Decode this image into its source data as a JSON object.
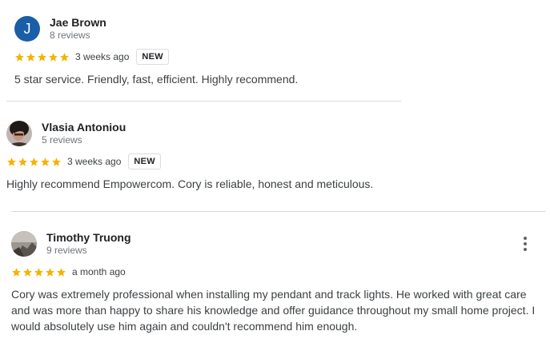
{
  "reviews": [
    {
      "avatar_letter": "J",
      "name": "Jae Brown",
      "review_count": "8 reviews",
      "stars": 5,
      "date": "3 weeks ago",
      "badge": "NEW",
      "text": "5 star service. Friendly, fast, efficient. Highly recommend."
    },
    {
      "name": "Vlasia Antoniou",
      "review_count": "5 reviews",
      "stars": 5,
      "date": "3 weeks ago",
      "badge": "NEW",
      "text": "Highly recommend Empowercom. Cory is reliable, honest and meticulous."
    },
    {
      "name": "Timothy Truong",
      "review_count": "9 reviews",
      "stars": 5,
      "date": "a month ago",
      "text": "Cory was extremely professional when installing my pendant and track lights. He worked with great care and was more than happy to share his knowledge and offer guidance throughout my small home project. I would absolutely use him again and couldn't recommend him enough."
    }
  ],
  "colors": {
    "star": "#f4b400",
    "avatar_bg": "#1a5ea8",
    "divider": "#d9d9d9"
  },
  "icons": {
    "star": "star-icon",
    "menu": "more-vert-icon"
  }
}
